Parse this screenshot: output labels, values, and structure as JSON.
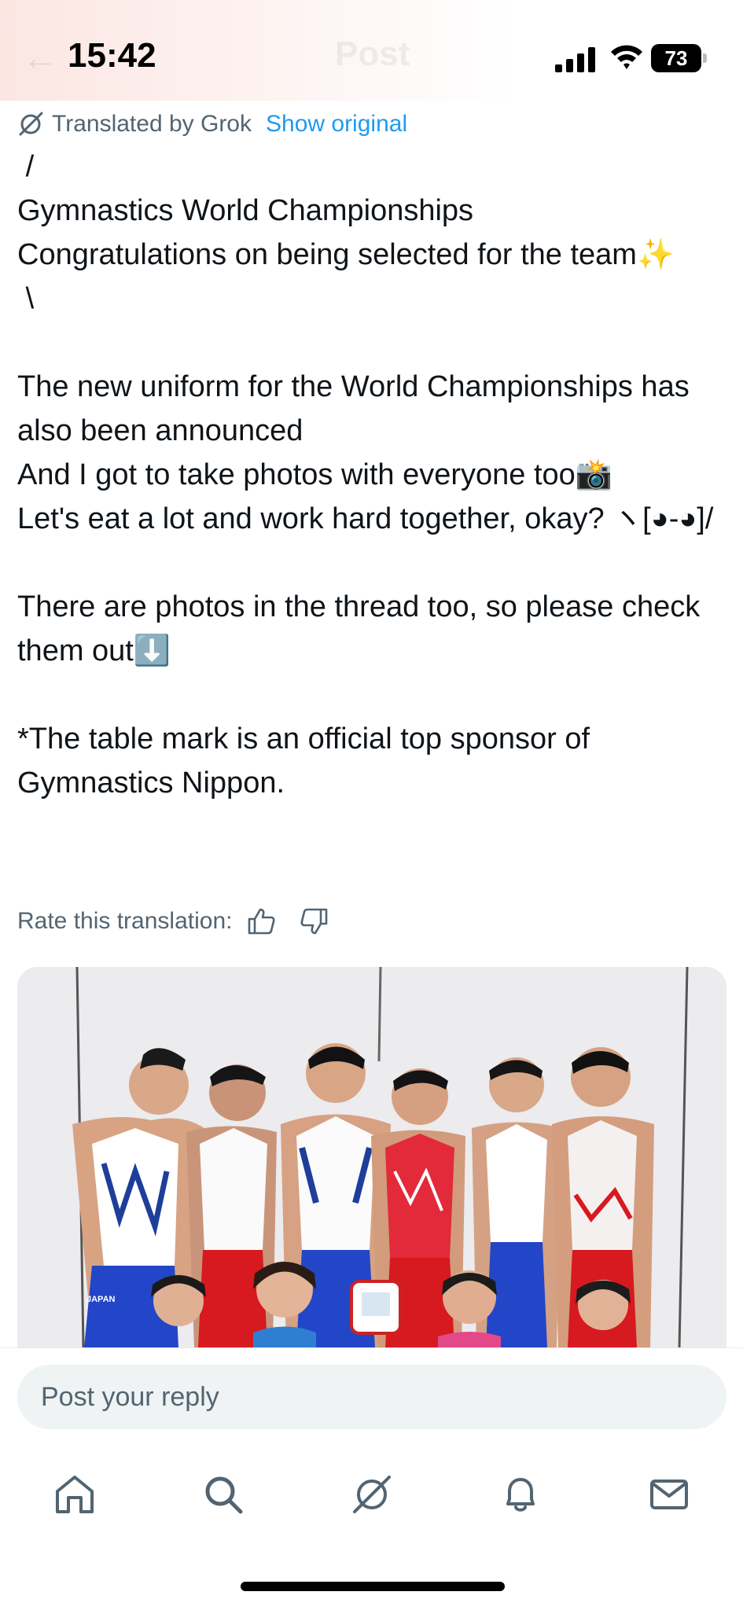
{
  "status_bar": {
    "time": "15:42",
    "battery": "73",
    "icons": [
      "cellular-signal-icon",
      "wifi-icon",
      "battery-icon"
    ]
  },
  "header": {
    "back_icon": "back-arrow-icon",
    "title": "Post"
  },
  "translation": {
    "icon": "grok-icon",
    "label": "Translated by Grok",
    "show_original": "Show original"
  },
  "post": {
    "text": " /\nGymnastics World Championships\nCongratulations on being selected for the team✨\n \\\n\nThe new uniform for the World Championships has also been announced\nAnd I got to take photos with everyone too📸\nLet's eat a lot and work hard together, okay? ヽ[◕-◕]/\n\nThere are photos in the thread too, so please check them out⬇️\n\n*The table mark is an official top sponsor of Gymnastics Nippon."
  },
  "rating": {
    "label": "Rate this translation:",
    "icons": [
      "thumbs-up-icon",
      "thumbs-down-icon"
    ]
  },
  "media": {
    "description_icon": "team-photo",
    "jersey_text": "JAPAN"
  },
  "reply": {
    "placeholder": "Post your reply"
  },
  "tab_bar": {
    "items": [
      "home-icon",
      "search-icon",
      "grok-icon",
      "notifications-icon",
      "messages-icon"
    ]
  },
  "colors": {
    "accent": "#1d9bf0",
    "secondary_text": "#536471",
    "text": "#0f1419",
    "input_bg": "#eff3f4"
  }
}
